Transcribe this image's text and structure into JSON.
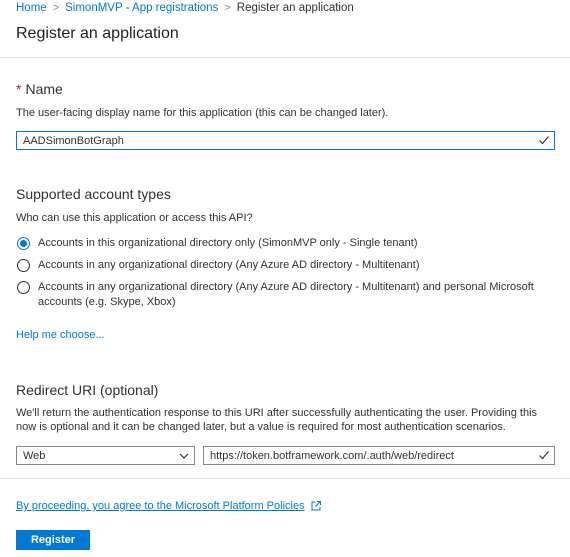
{
  "breadcrumb": {
    "home": "Home",
    "parent": "SimonMVP - App registrations",
    "current": "Register an application",
    "separator": ">"
  },
  "page_title": "Register an application",
  "name_section": {
    "required_marker": "*",
    "heading": "Name",
    "description": "The user-facing display name for this application (this can be changed later).",
    "input_value": "AADSimonBotGraph"
  },
  "account_types": {
    "heading": "Supported account types",
    "question": "Who can use this application or access this API?",
    "options": [
      {
        "label": "Accounts in this organizational directory only (SimonMVP only - Single tenant)",
        "selected": true
      },
      {
        "label": "Accounts in any organizational directory (Any Azure AD directory - Multitenant)",
        "selected": false
      },
      {
        "label": "Accounts in any organizational directory (Any Azure AD directory - Multitenant) and personal Microsoft accounts (e.g. Skype, Xbox)",
        "selected": false
      }
    ],
    "help_link": "Help me choose..."
  },
  "redirect": {
    "heading": "Redirect URI (optional)",
    "description": "We'll return the authentication response to this URI after successfully authenticating the user. Providing this now is optional and it can be changed later, but a value is required for most authentication scenarios.",
    "platform_value": "Web",
    "uri_value": "https://token.botframework.com/.auth/web/redirect"
  },
  "policy_text": "By proceeding, you agree to the Microsoft Platform Policies",
  "register_label": "Register",
  "colors": {
    "accent": "#0078d4",
    "required": "#a4262c",
    "valid_check": "#107c10"
  },
  "icons": {
    "input_check": "checkmark-icon",
    "select_chevron": "chevron-down-icon",
    "external_link": "external-link-icon"
  }
}
